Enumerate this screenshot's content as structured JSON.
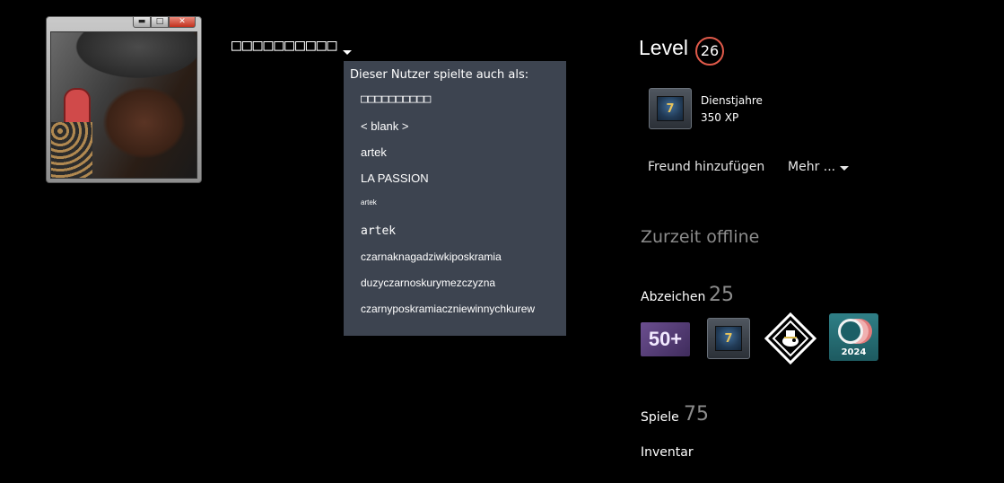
{
  "profile": {
    "player_name": "󠀠󠀠󠀠󠀠󠀠󠀠󠀠󠀠󠀠󠀠",
    "player_name_display": "□□□□□□□□□□"
  },
  "aliases": {
    "heading": "Dieser Nutzer spielte auch als:",
    "items": [
      "□□□□□□□□□□",
      "< blank >",
      "artek",
      "LA PASSION",
      "artek",
      "artek",
      "czarnaknagadziwkiposkramia",
      "duzyczarnoskurymezczyzna",
      "czarnyposkramiaczniewinnychkurew"
    ]
  },
  "level": {
    "label": "Level",
    "value": "26"
  },
  "featured_badge": {
    "title": "Dienstjahre",
    "xp": "350 XP",
    "icon": "years-of-service-badge-icon",
    "numeral": "7"
  },
  "actions": {
    "add_friend": "Freund hinzufügen",
    "more": "Mehr ..."
  },
  "status": "Zurzeit offline",
  "badges": {
    "label": "Abzeichen",
    "count": "25",
    "items": [
      {
        "icon": "fifty-plus-badge-icon",
        "text": "50+"
      },
      {
        "icon": "years-of-service-badge-icon",
        "text": "7"
      },
      {
        "icon": "diamond-badge-icon",
        "text": ""
      },
      {
        "icon": "steam-2024-badge-icon",
        "text": "2024"
      }
    ]
  },
  "games": {
    "label": "Spiele",
    "count": "75"
  },
  "inventory": {
    "label": "Inventar"
  },
  "colors": {
    "background": "#000000",
    "dropdown_bg": "#3d4450",
    "level_ring": "#e05a4a",
    "muted_text": "#8c8c8c"
  }
}
